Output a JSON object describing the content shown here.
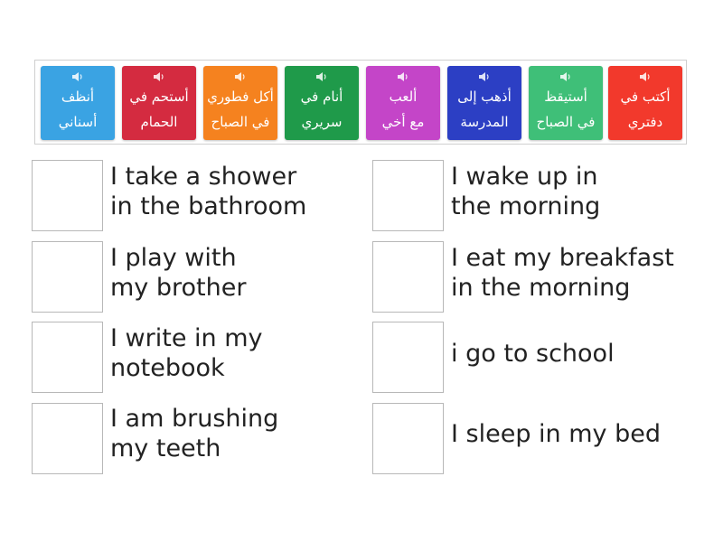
{
  "tiles": [
    {
      "line1": "أنظف",
      "line2": "أسناني",
      "color": "#3aa3e3",
      "icon": "speaker-icon"
    },
    {
      "line1": "أستحم في",
      "line2": "الحمام",
      "color": "#d42b40",
      "icon": "speaker-icon"
    },
    {
      "line1": "أكل فطوري",
      "line2": "في الصباح",
      "color": "#f5821f",
      "icon": "speaker-icon"
    },
    {
      "line1": "أنام في",
      "line2": "سريري",
      "color": "#1f9a4a",
      "icon": "speaker-icon"
    },
    {
      "line1": "ألعب",
      "line2": "مع أخي",
      "color": "#c445c8",
      "icon": "speaker-icon"
    },
    {
      "line1": "أذهب إلى",
      "line2": "المدرسة",
      "color": "#2c3fc4",
      "icon": "speaker-icon"
    },
    {
      "line1": "أستيقظ",
      "line2": "في الصباح",
      "color": "#3fbf78",
      "icon": "speaker-icon"
    },
    {
      "line1": "أكتب في",
      "line2": "دفتري",
      "color": "#f2392c",
      "icon": "speaker-icon"
    }
  ],
  "phrases": {
    "left": [
      {
        "line1": "I take a shower",
        "line2": "in the bathroom"
      },
      {
        "line1": "I play with",
        "line2": "my brother"
      },
      {
        "line1": "I write in my",
        "line2": "notebook"
      },
      {
        "line1": "I am brushing",
        "line2": "my teeth"
      }
    ],
    "right": [
      {
        "line1": "I wake up in",
        "line2": "the morning"
      },
      {
        "line1": "I eat my breakfast",
        "line2": "in the morning"
      },
      {
        "line1": "i go to school",
        "line2": ""
      },
      {
        "line1": "I sleep in my bed",
        "line2": ""
      }
    ]
  }
}
